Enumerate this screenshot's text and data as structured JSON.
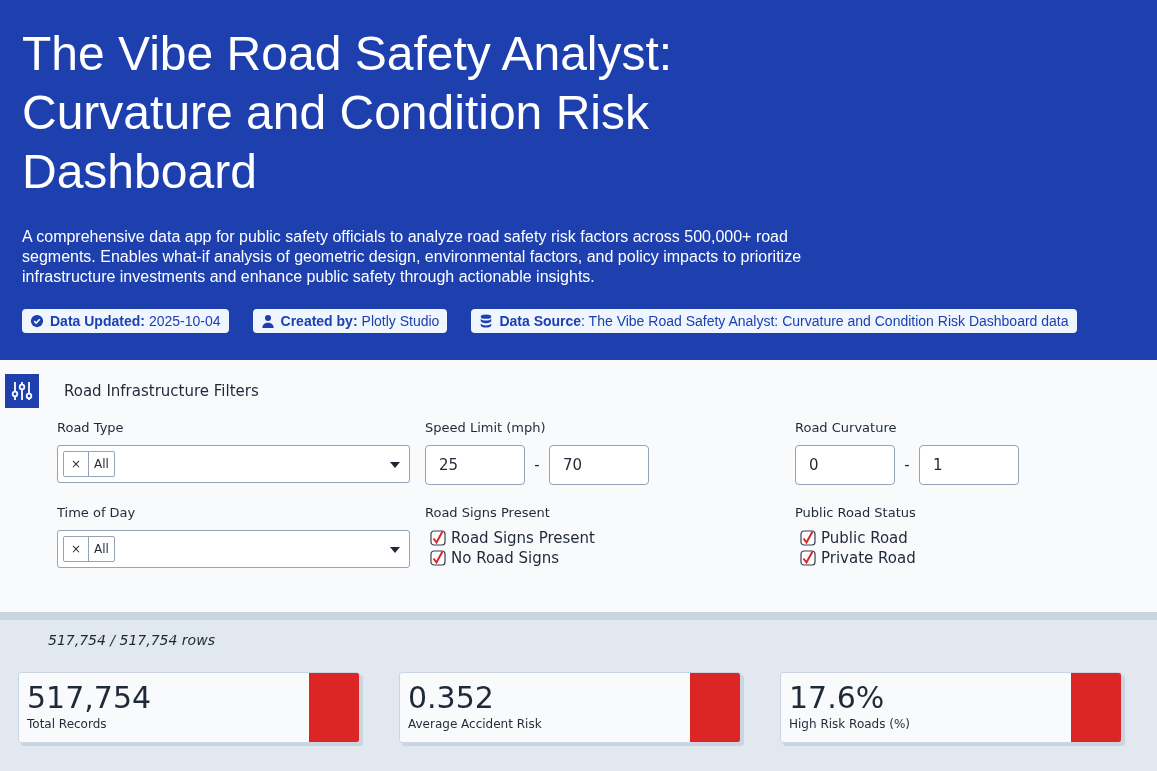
{
  "header": {
    "title": "The Vibe Road Safety Analyst: Curvature and Condition Risk Dashboard",
    "description": "A comprehensive data app for public safety officials to analyze road safety risk factors across 500,000+ road segments. Enables what-if analysis of geometric design, environmental factors, and policy impacts to prioritize infrastructure investments and enhance public safety through actionable insights.",
    "badges": [
      {
        "kind": "check",
        "label": "Data Updated:",
        "value": "2025-10-04"
      },
      {
        "kind": "user",
        "label": "Created by:",
        "value": "Plotly Studio"
      },
      {
        "kind": "database",
        "label": "Data Source",
        "value": ": The Vibe Road Safety Analyst: Curvature and Condition Risk Dashboard data"
      }
    ]
  },
  "filters": {
    "title": "Road Infrastructure Filters",
    "items": [
      {
        "kind": "select",
        "label": "Road Type",
        "chips": [
          "All"
        ],
        "remove": "×"
      },
      {
        "kind": "range",
        "label": "Speed Limit (mph)",
        "min": "25",
        "max": "70",
        "separator": "-"
      },
      {
        "kind": "range",
        "label": "Road Curvature",
        "min": "0",
        "max": "1",
        "separator": "-"
      },
      {
        "kind": "select",
        "label": "Time of Day",
        "chips": [
          "All"
        ],
        "remove": "×"
      },
      {
        "kind": "checks",
        "label": "Road Signs Present",
        "options": [
          {
            "label": "Road Signs Present",
            "checked": true
          },
          {
            "label": "No Road Signs",
            "checked": true
          }
        ]
      },
      {
        "kind": "checks",
        "label": "Public Road Status",
        "options": [
          {
            "label": "Public Road",
            "checked": true
          },
          {
            "label": "Private Road",
            "checked": true
          }
        ]
      }
    ]
  },
  "row_count": "517,754 / 517,754 rows",
  "metrics": [
    {
      "value": "517,754",
      "label": "Total Records",
      "color": "#dc2626"
    },
    {
      "value": "0.352",
      "label": "Average Accident Risk",
      "color": "#dc2626"
    },
    {
      "value": "17.6%",
      "label": "High Risk Roads (%)",
      "color": "#dc2626"
    }
  ]
}
